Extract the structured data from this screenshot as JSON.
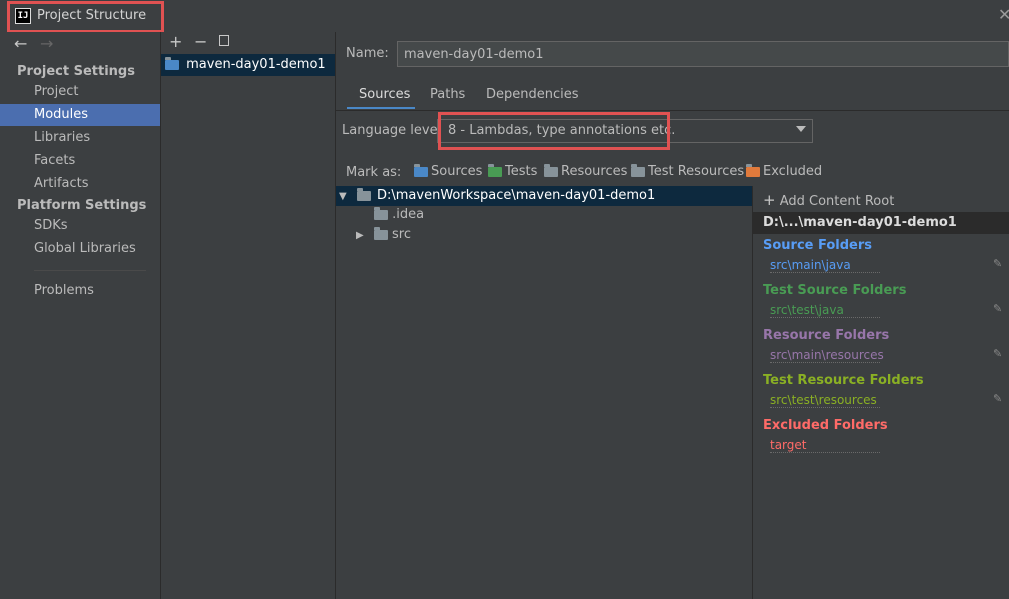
{
  "window": {
    "title": "Project Structure",
    "app_icon_text": "IJ"
  },
  "nav": {
    "back_icon": "arrow-left-icon",
    "forward_icon": "arrow-right-icon",
    "project_settings_header": "Project Settings",
    "platform_settings_header": "Platform Settings",
    "items": [
      {
        "label": "Project"
      },
      {
        "label": "Modules",
        "selected": true
      },
      {
        "label": "Libraries"
      },
      {
        "label": "Facets"
      },
      {
        "label": "Artifacts"
      },
      {
        "label": "SDKs"
      },
      {
        "label": "Global Libraries"
      },
      {
        "label": "Problems"
      }
    ]
  },
  "modules": {
    "toolbar": {
      "add": "+",
      "remove": "−",
      "copy_icon": "copy-icon"
    },
    "items": [
      {
        "label": "maven-day01-demo1"
      }
    ]
  },
  "main": {
    "name_label": "Name:",
    "name_value": "maven-day01-demo1",
    "tabs": [
      {
        "label": "Sources",
        "active": true
      },
      {
        "label": "Paths"
      },
      {
        "label": "Dependencies"
      }
    ],
    "language_level_label": "Language level:",
    "language_level_value": "8 - Lambdas, type annotations etc.",
    "mark_as_label": "Mark as:",
    "mark_as": [
      {
        "label": "Sources",
        "color": "#4a88c7"
      },
      {
        "label": "Tests",
        "color": "#499c54"
      },
      {
        "label": "Resources",
        "color": "#87939a"
      },
      {
        "label": "Test Resources",
        "color": "#87939a"
      },
      {
        "label": "Excluded",
        "color": "#e07a3c"
      }
    ]
  },
  "tree": {
    "root": "D:\\mavenWorkspace\\maven-day01-demo1",
    "children": [
      {
        "label": ".idea"
      },
      {
        "label": "src",
        "collapsed": true
      }
    ]
  },
  "content_root": {
    "add_label": "Add Content Root",
    "path": "D:\\...\\maven-day01-demo1",
    "groups": [
      {
        "title": "Source Folders",
        "path": "src\\main\\java",
        "color": "#589df6"
      },
      {
        "title": "Test Source Folders",
        "path": "src\\test\\java",
        "color": "#499c54"
      },
      {
        "title": "Resource Folders",
        "path": "src\\main\\resources",
        "color": "#9876aa"
      },
      {
        "title": "Test Resource Folders",
        "path": "src\\test\\resources",
        "color": "#8ab024"
      },
      {
        "title": "Excluded Folders",
        "path": "target",
        "color": "#ff6b68"
      }
    ]
  }
}
